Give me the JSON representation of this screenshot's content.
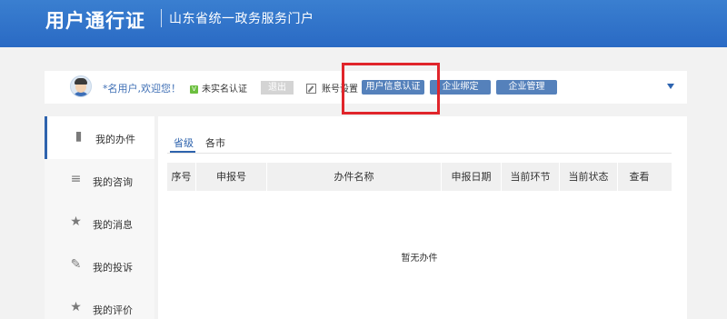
{
  "header": {
    "title": "用户通行证",
    "subtitle": "山东省统一政务服务门户"
  },
  "userbar": {
    "greeting": "*名用户,欢迎您！",
    "verify_badge": "V",
    "verify_status": "未实名认证",
    "logout": "退出",
    "account_settings": "账号设置",
    "buttons": [
      "用户信息认证",
      "企业绑定",
      "企业管理"
    ]
  },
  "sidebar": {
    "items": [
      {
        "label": "我的办件",
        "icon": "bar-chart-icon",
        "glyph": "▮"
      },
      {
        "label": "我的咨询",
        "icon": "database-icon",
        "glyph": "≡"
      },
      {
        "label": "我的消息",
        "icon": "star-icon",
        "glyph": "★"
      },
      {
        "label": "我的投诉",
        "icon": "book-icon",
        "glyph": "✎"
      },
      {
        "label": "我的评价",
        "icon": "star-icon",
        "glyph": "★"
      }
    ]
  },
  "main": {
    "tabs": [
      "省级",
      "各市"
    ],
    "columns": [
      "序号",
      "申报号",
      "办件名称",
      "申报日期",
      "当前环节",
      "当前状态",
      "查看"
    ],
    "empty_text": "暂无办件"
  },
  "colors": {
    "header_blue": "#2a6ac4",
    "pill_blue": "#5581bb",
    "highlight_red": "#e0252b"
  }
}
